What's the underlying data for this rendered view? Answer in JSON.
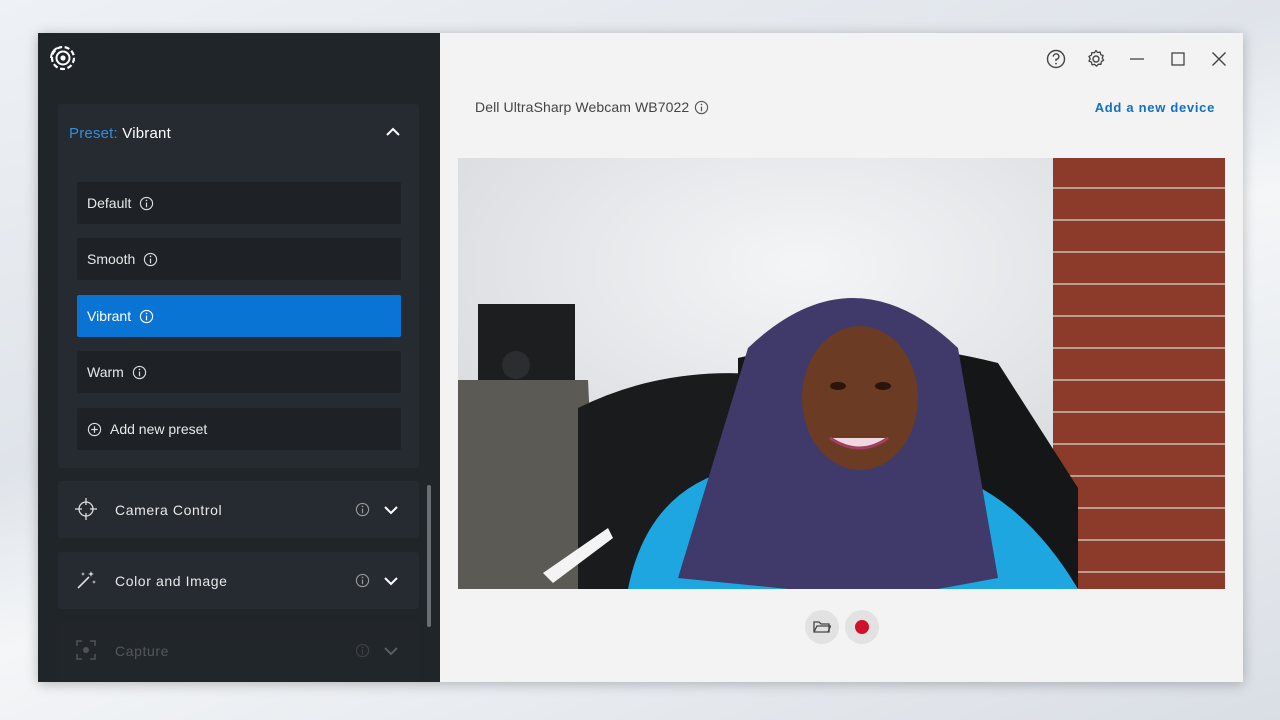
{
  "sidebar": {
    "logo_icon": "webcam-settings-logo-icon",
    "preset": {
      "key_label": "Preset:",
      "value": "Vibrant",
      "items": [
        {
          "label": "Default"
        },
        {
          "label": "Smooth"
        },
        {
          "label": "Vibrant"
        },
        {
          "label": "Warm"
        }
      ],
      "add_label": "Add new preset"
    },
    "sections": [
      {
        "label": "Camera Control"
      },
      {
        "label": "Color and Image"
      },
      {
        "label": "Capture"
      }
    ]
  },
  "header": {
    "device_name": "Dell UltraSharp Webcam WB7022",
    "add_device": "Add a new device"
  },
  "colors": {
    "accent": "#0a74d4",
    "sidebar_bg": "#20252a",
    "record": "#d0112b"
  }
}
